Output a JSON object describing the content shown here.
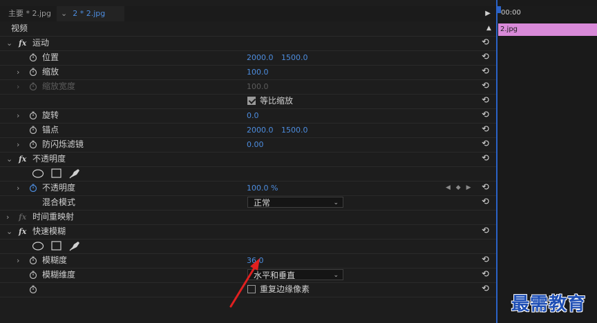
{
  "tabs": [
    {
      "label": "主要 * 2.jpg"
    },
    {
      "label": "2 * 2.jpg"
    }
  ],
  "timeline": {
    "time": "00:00",
    "clip_label": "2.jpg"
  },
  "section": {
    "title": "视频"
  },
  "motion": {
    "label": "运动",
    "position": {
      "label": "位置",
      "x": "2000.0",
      "y": "1500.0"
    },
    "scale": {
      "label": "缩放",
      "value": "100.0"
    },
    "scale_width": {
      "label": "缩放宽度",
      "value": "100.0"
    },
    "uniform_scale": {
      "label": "等比缩放"
    },
    "rotation": {
      "label": "旋转",
      "value": "0.0"
    },
    "anchor": {
      "label": "锚点",
      "x": "2000.0",
      "y": "1500.0"
    },
    "anti_flicker": {
      "label": "防闪烁滤镜",
      "value": "0.00"
    }
  },
  "opacity": {
    "label": "不透明度",
    "opacity_param": {
      "label": "不透明度",
      "value": "100.0 %"
    },
    "blend_mode": {
      "label": "混合模式",
      "value": "正常"
    }
  },
  "time_remap": {
    "label": "时间重映射"
  },
  "fast_blur": {
    "label": "快速模糊",
    "blurriness": {
      "label": "模糊度",
      "value": "36.0"
    },
    "blur_dimensions": {
      "label": "模糊维度",
      "value": "水平和垂直"
    },
    "repeat_edge": {
      "label": "重复边缘像素"
    }
  },
  "watermark": "最需教育",
  "colors": {
    "accent": "#4d8ddf",
    "clip": "#d98ad9",
    "watermark": "#1f4fb5",
    "annotation": "#e02020"
  }
}
